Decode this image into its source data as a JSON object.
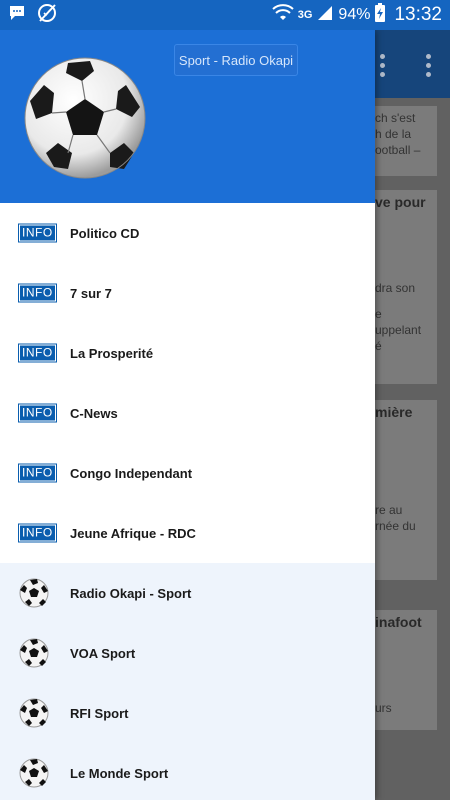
{
  "status_bar": {
    "battery": "94%",
    "time": "13:32",
    "network": "3G"
  },
  "drawer": {
    "header_title": "Sport - Radio Okapi",
    "info_badge": "INFO",
    "news_items": [
      {
        "label": "Politico CD"
      },
      {
        "label": "7 sur 7"
      },
      {
        "label": "La Prosperité"
      },
      {
        "label": "C-News"
      },
      {
        "label": "Congo Independant"
      },
      {
        "label": "Jeune Afrique - RDC"
      }
    ],
    "sport_items": [
      {
        "label": "Radio Okapi - Sport"
      },
      {
        "label": "VOA Sport"
      },
      {
        "label": "RFI Sport"
      },
      {
        "label": "Le Monde Sport"
      }
    ]
  },
  "background": {
    "card1_lines": [
      "ch s'est",
      "h de la",
      "ootball –"
    ],
    "card2_title": "ve pour",
    "card2_lines": [
      "dra son",
      "e",
      "uppelant",
      "é"
    ],
    "card3_title": "mière",
    "card3_lines": [
      "re au",
      "rnée du"
    ],
    "card4_title": "inafoot",
    "card4_lines": [
      "urs"
    ]
  },
  "colors": {
    "status_bar": "#1565c0",
    "drawer_header": "#1c6fd6",
    "info_badge": "#0a5dae",
    "sport_row_bg": "#eef4fc"
  }
}
